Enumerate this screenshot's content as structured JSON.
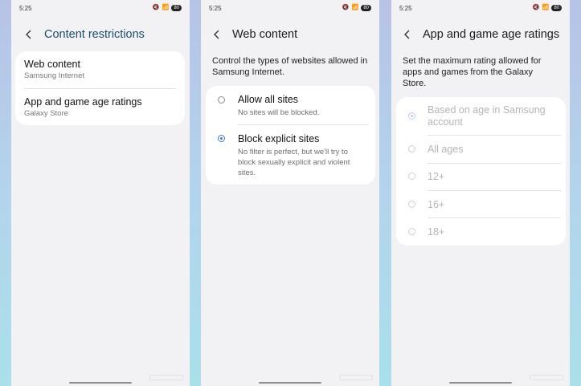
{
  "status": {
    "time": "5:25",
    "battery": "80"
  },
  "screen1": {
    "title": "Content restrictions",
    "items": [
      {
        "title": "Web content",
        "subtitle": "Samsung Internet"
      },
      {
        "title": "App and game age ratings",
        "subtitle": "Galaxy Store"
      }
    ]
  },
  "screen2": {
    "title": "Web content",
    "description": "Control the types of websites allowed in Samsung Internet.",
    "options": [
      {
        "title": "Allow all sites",
        "subtitle": "No sites will be blocked.",
        "selected": false
      },
      {
        "title": "Block explicit sites",
        "subtitle": "No filter is perfect, but we'll try to block sexually explicit and violent sites.",
        "selected": true
      }
    ]
  },
  "screen3": {
    "title": "App and game age ratings",
    "description": "Set the maximum rating allowed for apps and games from the Galaxy Store.",
    "options": [
      {
        "label": "Based on age in Samsung account",
        "selected": true
      },
      {
        "label": "All ages",
        "selected": false
      },
      {
        "label": "12+",
        "selected": false
      },
      {
        "label": "16+",
        "selected": false
      },
      {
        "label": "18+",
        "selected": false
      }
    ],
    "disabled": true
  },
  "colors": {
    "accent": "#3f76d8",
    "background": "#f2f2f4",
    "card": "#ffffff"
  }
}
